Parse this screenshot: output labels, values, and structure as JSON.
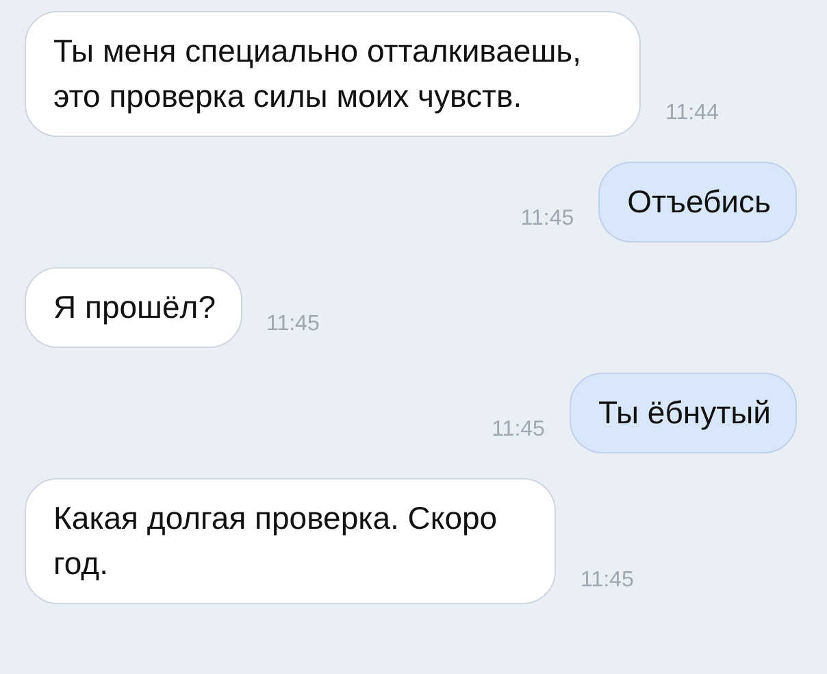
{
  "messages": [
    {
      "kind": "incoming",
      "text": "Ты меня специально отталкиваешь, это проверка силы моих чувств.",
      "time": "11:44"
    },
    {
      "kind": "outgoing",
      "text": "Отъебись",
      "time": "11:45"
    },
    {
      "kind": "incoming",
      "text": "Я прошёл?",
      "time": "11:45"
    },
    {
      "kind": "outgoing",
      "text": "Ты ёбнутый",
      "time": "11:45"
    },
    {
      "kind": "incoming",
      "text": "Какая долгая проверка. Скоро год.",
      "time": "11:45"
    }
  ]
}
